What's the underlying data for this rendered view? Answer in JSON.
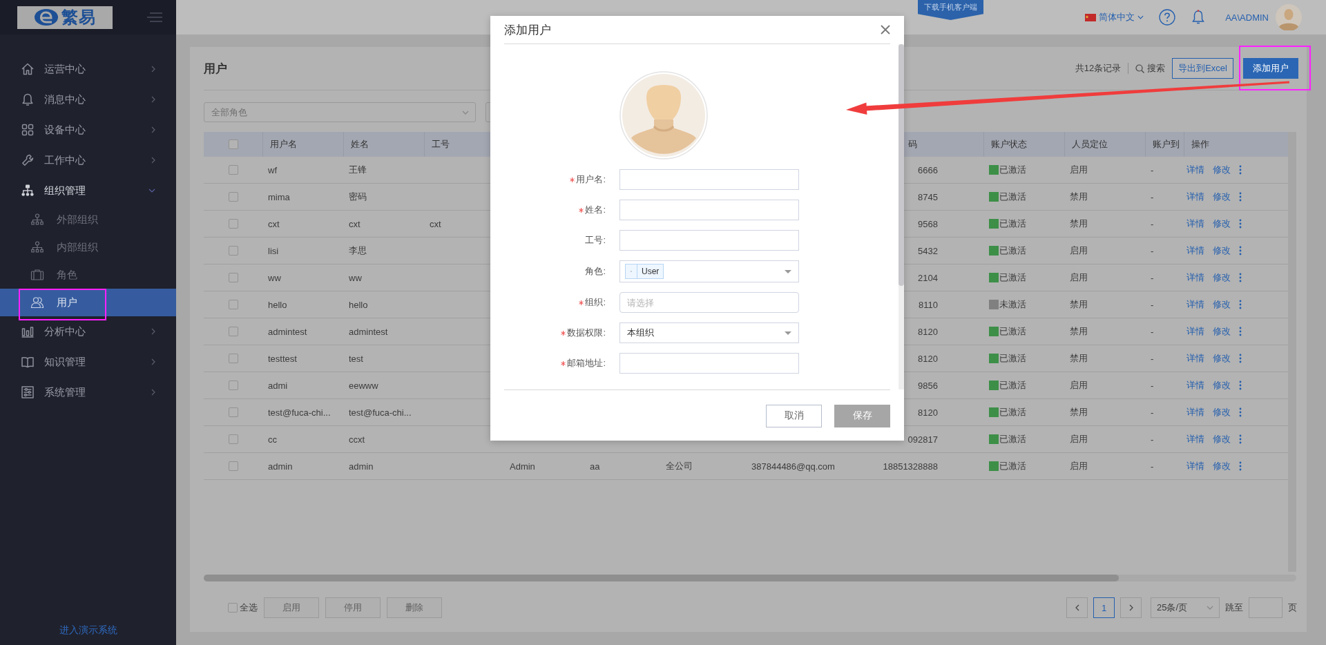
{
  "sidebar": {
    "logo": "繁易",
    "items": [
      {
        "label": "运营中心",
        "expanded": false,
        "selected": false
      },
      {
        "label": "消息中心",
        "expanded": false,
        "selected": false
      },
      {
        "label": "设备中心",
        "expanded": false,
        "selected": false
      },
      {
        "label": "工作中心",
        "expanded": false,
        "selected": false
      },
      {
        "label": "组织管理",
        "expanded": true,
        "selected": false,
        "children": [
          {
            "label": "外部组织",
            "selected": false
          },
          {
            "label": "内部组织",
            "selected": false
          },
          {
            "label": "角色",
            "selected": false
          },
          {
            "label": "用户",
            "selected": true
          }
        ]
      },
      {
        "label": "分析中心",
        "expanded": false,
        "selected": false
      },
      {
        "label": "知识管理",
        "expanded": false,
        "selected": false
      },
      {
        "label": "系统管理",
        "expanded": false,
        "selected": false
      }
    ],
    "footer_link": "进入演示系统"
  },
  "topbar": {
    "download_badge": "下载手机客户端",
    "language": "简体中文",
    "user": "AA\\ADMIN"
  },
  "page": {
    "title": "用户",
    "record_count": "共12条记录",
    "search": "搜索",
    "export_button": "导出到Excel",
    "add_button": "添加用户",
    "filter": {
      "placeholder": "全部角色"
    }
  },
  "table": {
    "header_checkbox": {
      "checked": false
    },
    "columns": {
      "username": "用户名",
      "name": "姓名",
      "employee_id": "工号",
      "column_8": "码",
      "account_status": "账户状态",
      "positioning": "人员定位",
      "column_11": "账户到",
      "actions": "操作"
    },
    "rows": [
      {
        "checked": false,
        "username": "wf",
        "name": "王锋",
        "column_8": "6666",
        "account_status": "已激活",
        "color": "#3d8f48",
        "positioning": "启用",
        "column_11": "-",
        "actions": [
          "详情",
          "修改"
        ]
      },
      {
        "checked": false,
        "username": "mima",
        "name": "密码",
        "column_8": "8745",
        "account_status": "已激活",
        "color": "#3d8f48",
        "positioning": "禁用",
        "column_11": "-",
        "actions": [
          "详情",
          "修改"
        ]
      },
      {
        "checked": false,
        "username": "cxt",
        "name": "cxt",
        "employee_id": "cxt",
        "column_8": "9568",
        "account_status": "已激活",
        "color": "#3d8f48",
        "positioning": "禁用",
        "column_11": "-",
        "actions": [
          "详情",
          "修改"
        ]
      },
      {
        "checked": false,
        "username": "lisi",
        "name": "李思",
        "column_8": "5432",
        "account_status": "已激活",
        "color": "#3d8f48",
        "positioning": "启用",
        "column_11": "-",
        "actions": [
          "详情",
          "修改"
        ]
      },
      {
        "checked": false,
        "username": "ww",
        "name": "ww",
        "column_8": "2104",
        "account_status": "已激活",
        "color": "#3d8f48",
        "positioning": "启用",
        "column_11": "-",
        "actions": [
          "详情",
          "修改"
        ]
      },
      {
        "checked": false,
        "username": "hello",
        "name": "hello",
        "column_8": "8110",
        "account_status": "未激活",
        "color": "#808080",
        "positioning": "禁用",
        "column_11": "-",
        "actions": [
          "详情",
          "修改"
        ]
      },
      {
        "checked": false,
        "username": "admintest",
        "name": "admintest",
        "column_8": "8120",
        "account_status": "已激活",
        "color": "#3d8f48",
        "positioning": "禁用",
        "column_11": "-",
        "actions": [
          "详情",
          "修改"
        ]
      },
      {
        "checked": false,
        "username": "testtest",
        "name": "test",
        "column_8": "8120",
        "account_status": "已激活",
        "color": "#3d8f48",
        "positioning": "禁用",
        "column_11": "-",
        "actions": [
          "详情",
          "修改"
        ]
      },
      {
        "checked": false,
        "username": "admi",
        "name": "eewww",
        "column_8": "9856",
        "account_status": "已激活",
        "color": "#3d8f48",
        "positioning": "启用",
        "column_11": "-",
        "actions": [
          "详情",
          "修改"
        ]
      },
      {
        "checked": false,
        "username": "test@fuca-chi...",
        "name": "test@fuca-chi...",
        "column_8": "8120",
        "account_status": "已激活",
        "color": "#3d8f48",
        "positioning": "禁用",
        "column_11": "-",
        "actions": [
          "详情",
          "修改"
        ]
      },
      {
        "checked": false,
        "username": "cc",
        "name": "ccxt",
        "column_8": "092817",
        "account_status": "已激活",
        "color": "#3d8f48",
        "positioning": "启用",
        "column_11": "-",
        "actions": [
          "详情",
          "修改"
        ]
      },
      {
        "checked": false,
        "username": "admin",
        "name": "admin",
        "column_4": "Admin",
        "column_5": "aa",
        "column_6": "全公司",
        "column_7": "387844486@qq.com",
        "column_8": "18851328888",
        "account_status": "已激活",
        "color": "#3d8f48",
        "positioning": "启用",
        "column_11": "-",
        "actions": [
          "详情",
          "修改"
        ]
      }
    ]
  },
  "footer": {
    "select_all": {
      "label": "全选",
      "checked": false
    },
    "buttons": [
      {
        "label": "启用",
        "disabled": true
      },
      {
        "label": "停用",
        "disabled": true
      },
      {
        "label": "删除",
        "disabled": true
      }
    ],
    "pages": [
      {
        "label": "1",
        "selected": true
      }
    ],
    "page_size": "25条/页",
    "jump_label": "跳至",
    "page_suffix": "页"
  },
  "dialog": {
    "title": "添加用户",
    "fields": [
      {
        "kind": "text",
        "label": "用户名:",
        "required": true
      },
      {
        "kind": "text",
        "label": "姓名:",
        "required": true
      },
      {
        "kind": "text",
        "label": "工号:",
        "required": false
      },
      {
        "kind": "tags",
        "label": "角色:",
        "required": false,
        "tags": [
          "User"
        ]
      },
      {
        "kind": "picker",
        "label": "组织:",
        "required": true,
        "placeholder": "请选择"
      },
      {
        "kind": "select",
        "label": "数据权限:",
        "required": true,
        "value": "本组织"
      },
      {
        "kind": "text",
        "label": "邮箱地址:",
        "required": true
      }
    ],
    "buttons": [
      {
        "label": "取消",
        "disabled": false
      },
      {
        "label": "保存",
        "disabled": true
      }
    ]
  }
}
